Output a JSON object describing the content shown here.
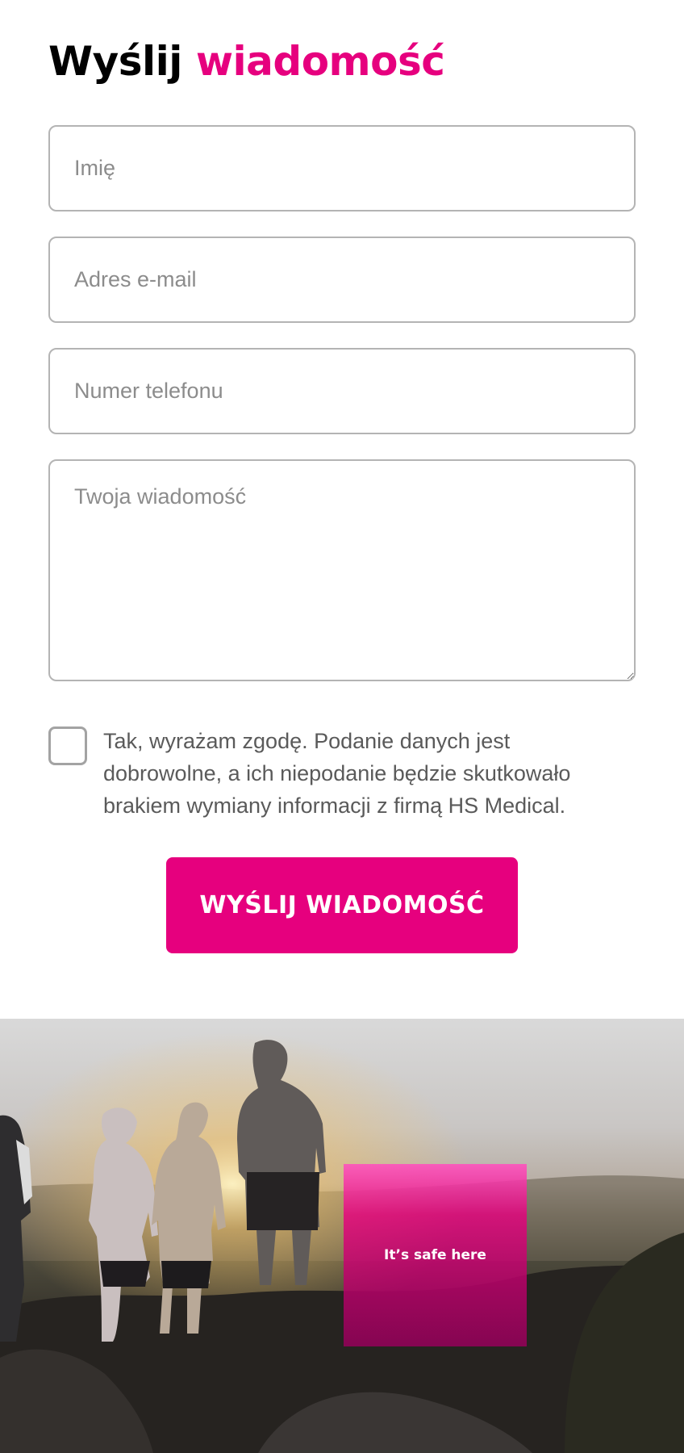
{
  "contact_form": {
    "heading_plain": "Wyślij",
    "heading_accent": "wiadomość",
    "name_placeholder": "Imię",
    "email_placeholder": "Adres e-mail",
    "phone_placeholder": "Numer telefonu",
    "message_placeholder": "Twoja wiadomość",
    "consent_text": "Tak, wyrażam zgodę. Podanie danych jest dobrowolne, a ich niepodanie będzie skutkowało brakiem wymiany informacji z firmą HS Medical.",
    "consent_checked": false,
    "submit_label": "WYŚLIJ WIADOMOŚĆ"
  },
  "hero_photo": {
    "badge_text": "It’s safe here"
  },
  "colors": {
    "accent": "#e6007e",
    "heading": "#000000",
    "field_border": "#b4b4b4",
    "placeholder": "#8c8c8c",
    "body_text": "#5a5a5a"
  }
}
